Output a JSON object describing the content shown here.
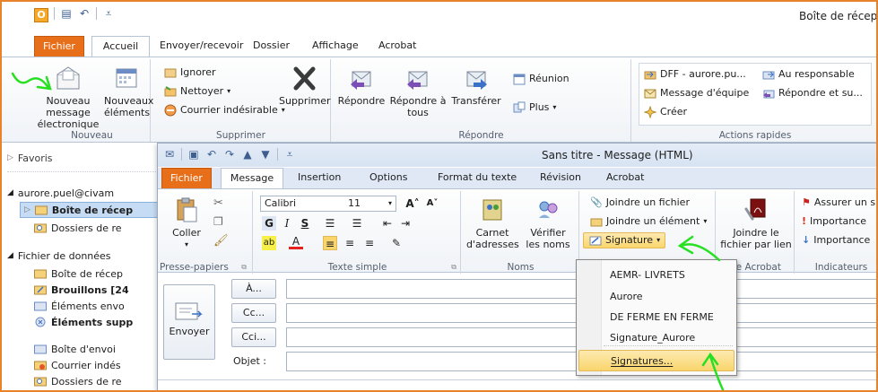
{
  "window": {
    "title": "Boîte de récept",
    "app_icon": "O"
  },
  "tabs": {
    "file": "Fichier",
    "items": [
      "Accueil",
      "Envoyer/recevoir",
      "Dossier",
      "Affichage",
      "Acrobat"
    ]
  },
  "ribbon": {
    "new_message": "Nouveau message électronique",
    "new_items": "Nouveaux éléments",
    "group_new": "Nouveau",
    "ignore": "Ignorer",
    "clean": "Nettoyer",
    "junk": "Courrier indésirable",
    "delete": "Supprimer",
    "group_delete": "Supprimer",
    "reply": "Répondre",
    "reply_all": "Répondre à tous",
    "forward": "Transférer",
    "meeting": "Réunion",
    "more": "Plus",
    "group_respond": "Répondre",
    "qs1": "DFF - aurore.pu...",
    "qs2": "Message d'équipe",
    "qs3": "Créer",
    "qs4": "Au responsable",
    "qs5": "Répondre et su...",
    "group_quicksteps": "Actions rapides"
  },
  "nav": {
    "favorites": "Favoris",
    "account": "aurore.puel@civam",
    "inbox": "Boîte de récep",
    "search_folders": "Dossiers de re",
    "data_file": "Fichier de données",
    "df_inbox": "Boîte de récep",
    "drafts": "Brouillons [24",
    "sent": "Éléments envo",
    "deleted": "Éléments supp",
    "outbox": "Boîte d'envoi",
    "junk": "Courrier indés",
    "df_search": "Dossiers de re"
  },
  "compose": {
    "title": "Sans titre  -  Message (HTML)",
    "tabs": {
      "file": "Fichier",
      "items": [
        "Message",
        "Insertion",
        "Options",
        "Format du texte",
        "Révision",
        "Acrobat"
      ]
    },
    "paste": "Coller",
    "group_clipboard": "Presse-papiers",
    "font_name": "Calibri",
    "font_size": "11",
    "group_basic_text": "Texte simple",
    "address_book": "Carnet d'adresses",
    "check_names": "Vérifier les noms",
    "group_names": "Noms",
    "attach_file": "Joindre un fichier",
    "attach_item": "Joindre un élément",
    "signature": "Signature",
    "attach_link": "Joindre le fichier par lien",
    "group_acrobat": "be Acrobat",
    "follow_up": "Assurer un s",
    "high_importance": "Importance",
    "low_importance": "Importance",
    "group_tags": "Indicateurs",
    "send": "Envoyer",
    "to": "À...",
    "cc": "Cc...",
    "bcc": "Cci...",
    "subject": "Objet :"
  },
  "signature_menu": {
    "items": [
      "AEMR- LIVRETS",
      "Aurore",
      "DE FERME EN FERME",
      "Signature_Aurore"
    ],
    "manage": "Signatures..."
  },
  "colors": {
    "file_tab": "#e76f1a",
    "frame": "#e9832b",
    "highlight": "#f9d56c",
    "annotation": "#27e021"
  }
}
